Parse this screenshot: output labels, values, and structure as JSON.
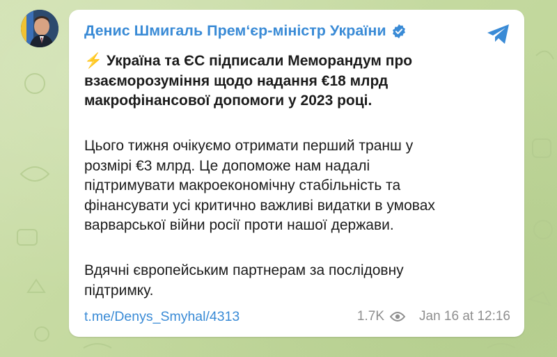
{
  "channel": {
    "name": "Денис Шмигаль Прем‘єр-міністр України",
    "accent": "#3a8bd6"
  },
  "message": {
    "emoji": "⚡",
    "headline": "Україна та ЄС підписали Меморандум про\nвзаєморозуміння щодо надання €18 млрд\nмакрофінансової допомоги у 2023 році.",
    "body": "Цього тижня очікуємо отримати перший транш у\nрозмірі €3 млрд. Це допоможе нам надалі\nпідтримувати макроекономічну стабільність та\nфінансувати усі критично важливі видатки в умовах\nварварської війни росії проти нашої держави.",
    "closing": "Вдячні європейським партнерам за послідовну\nпідтримку.",
    "link": "t.me/Denys_Smyhal/4313",
    "views": "1.7K",
    "date": "Jan 16 at 12:16"
  },
  "icons": {
    "verified": "verified-badge-icon",
    "share": "telegram-share-icon",
    "views": "eye-icon"
  }
}
